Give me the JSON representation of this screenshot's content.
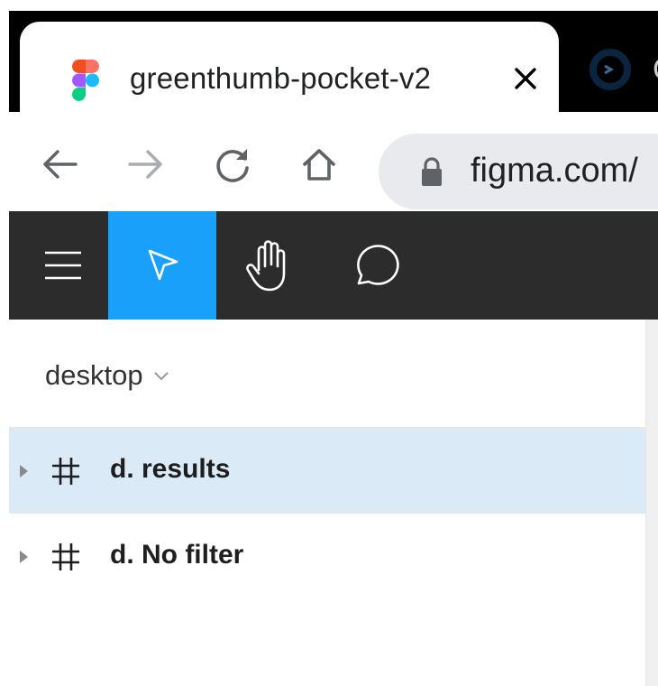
{
  "browser": {
    "active_tab": {
      "title": "greenthumb-pocket-v2",
      "icon": "figma-logo-icon"
    },
    "second_tab": {
      "icon": "tab-favicon-icon",
      "letter": "C"
    },
    "nav": {
      "back_icon": "back-arrow-icon",
      "forward_icon": "forward-arrow-icon",
      "reload_icon": "reload-icon",
      "home_icon": "home-icon"
    },
    "address_bar": {
      "url": "figma.com/",
      "lock_icon": "lock-icon"
    }
  },
  "toolbar": {
    "tools": [
      {
        "name": "menu",
        "icon": "hamburger-menu-icon",
        "active": false
      },
      {
        "name": "move",
        "icon": "cursor-arrow-icon",
        "active": true
      },
      {
        "name": "hand",
        "icon": "hand-icon",
        "active": false
      },
      {
        "name": "comment",
        "icon": "comment-bubble-icon",
        "active": false
      }
    ],
    "colors": {
      "background": "#2c2c2c",
      "active": "#18a0fb"
    }
  },
  "layers_panel": {
    "page": "desktop",
    "layers": [
      {
        "name": "d. results",
        "type": "frame",
        "selected": true
      },
      {
        "name": "d. No filter",
        "type": "frame",
        "selected": false
      }
    ],
    "colors": {
      "selected_row": "#daebf7"
    }
  }
}
